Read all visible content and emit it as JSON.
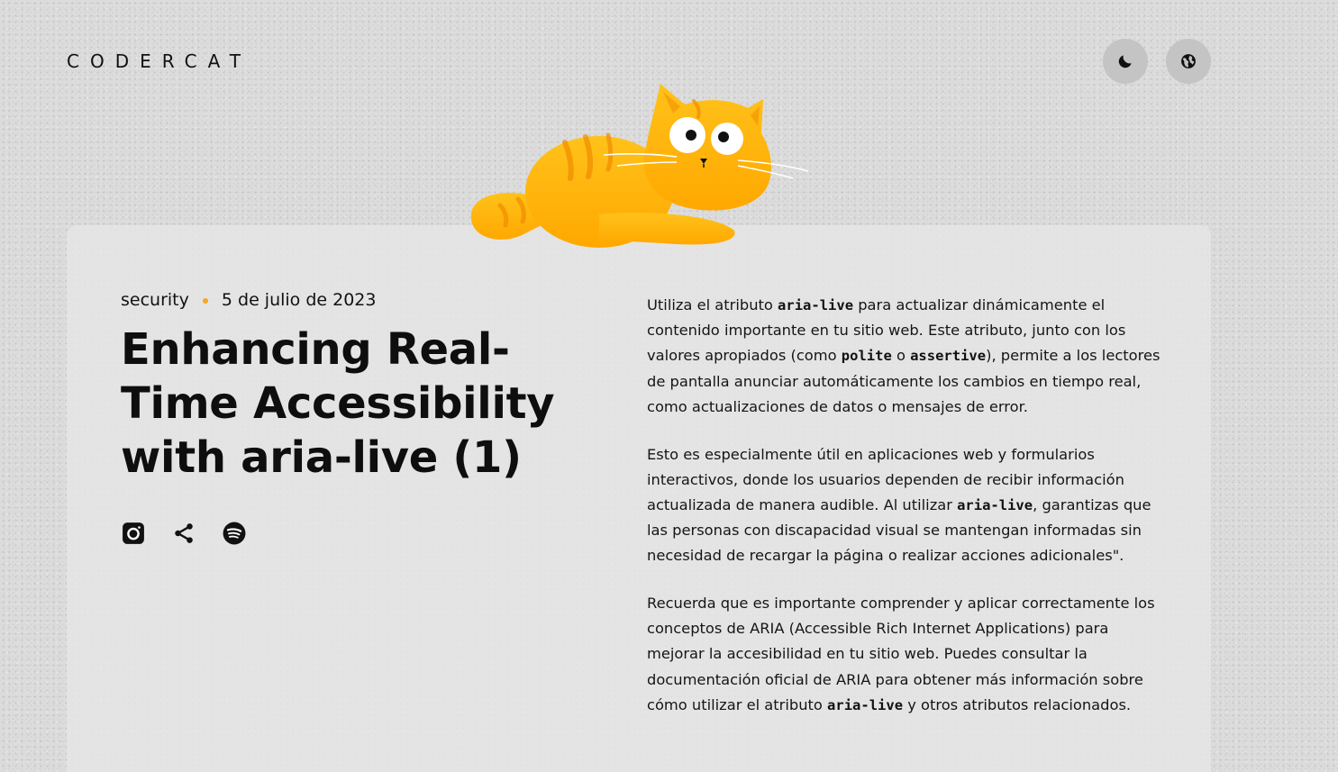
{
  "header": {
    "logo": "CODERCAT",
    "theme_icon": "moon-icon",
    "language_icon": "globe-icon"
  },
  "mascot": {
    "icon": "cat-mascot-illustration"
  },
  "post": {
    "category": "security",
    "date": "5 de julio de 2023",
    "title": "Enhancing Real-Time Accessibility with aria-live (1)",
    "social_icons": [
      "instagram-icon",
      "share-icon",
      "spotify-icon"
    ],
    "paragraphs": [
      {
        "p1_t1": "Utiliza el atributo ",
        "p1_c1": "aria-live",
        "p1_t2": " para actualizar dinámicamente el contenido importante en tu sitio web. Este atributo, junto con los valores apropiados (como ",
        "p1_c2": "polite",
        "p1_t3": " o ",
        "p1_c3": "assertive",
        "p1_t4": "), permite a los lectores de pantalla anunciar automáticamente los cambios en tiempo real, como actualizaciones de datos o mensajes de error."
      },
      {
        "p2_t1": "Esto es especialmente útil en aplicaciones web y formularios interactivos, donde los usuarios dependen de recibir información actualizada de manera audible. Al utilizar ",
        "p2_c1": "aria-live",
        "p2_t2": ", garantizas que las personas con discapacidad visual se mantengan informadas sin necesidad de recargar la página o realizar acciones adicionales\"."
      },
      {
        "p3_t1": "Recuerda que es importante comprender y aplicar correctamente los conceptos de ARIA (Accessible Rich Internet Applications) para mejorar la accesibilidad en tu sitio web. Puedes consultar la documentación oficial de ARIA para obtener más información sobre cómo utilizar el atributo ",
        "p3_c1": "aria-live",
        "p3_t2": " y otros atributos relacionados."
      }
    ]
  },
  "colors": {
    "background": "#dcdcdc",
    "card": "#e5e5e5",
    "accent_dot": "#f5a623",
    "cat_orange": "#ffb300",
    "button_bg": "#c4c4c4"
  }
}
